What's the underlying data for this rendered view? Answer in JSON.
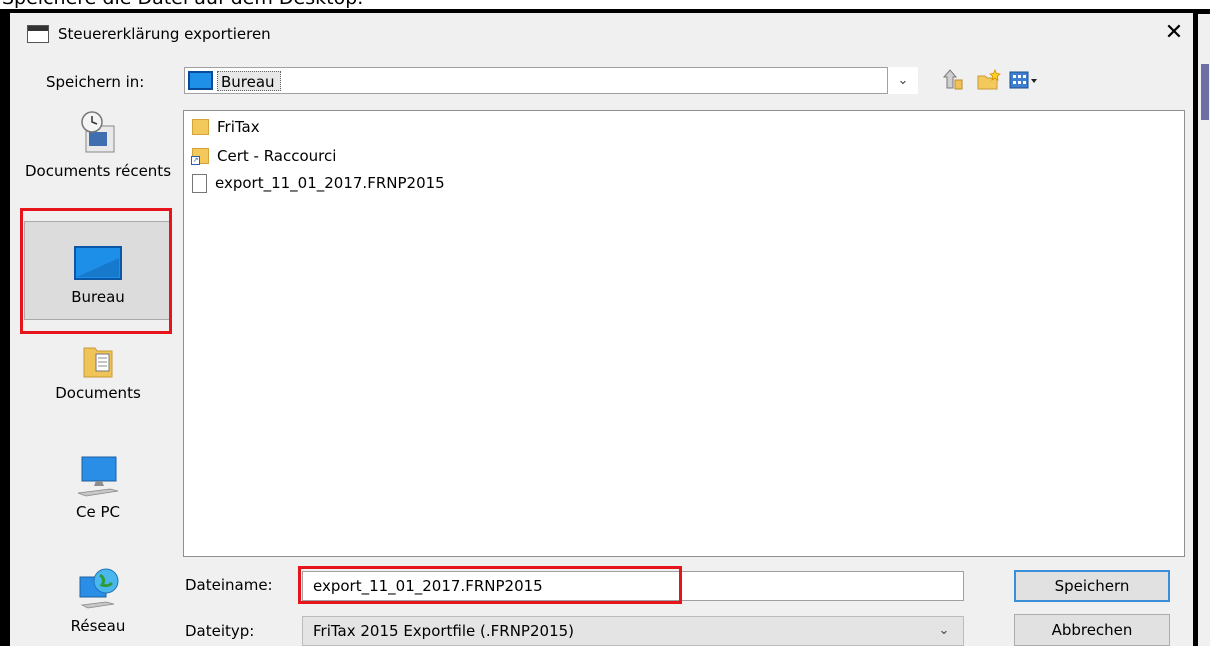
{
  "top_caption": "Speichere die Datei auf dem Desktop.",
  "window": {
    "title": "Steuererklärung exportieren",
    "close_glyph": "✕"
  },
  "save_in": {
    "label": "Speichern in:",
    "value": "Bureau",
    "icon": "desktop-icon"
  },
  "toolbar": {
    "icons": [
      "up-folder-icon",
      "new-folder-icon",
      "view-menu-icon"
    ]
  },
  "places": [
    {
      "label": "Documents récents",
      "icon": "recent-documents-icon"
    },
    {
      "label": "Bureau",
      "icon": "desktop-icon",
      "selected": true
    },
    {
      "label": "Documents",
      "icon": "documents-folder-icon"
    },
    {
      "label": "Ce PC",
      "icon": "computer-icon"
    },
    {
      "label": "Réseau",
      "icon": "network-globe-icon"
    }
  ],
  "files": [
    {
      "name": "FriTax",
      "type": "folder"
    },
    {
      "name": "Cert - Raccourci",
      "type": "folder-shortcut"
    },
    {
      "name": "export_11_01_2017.FRNP2015",
      "type": "file"
    }
  ],
  "file_name": {
    "label": "Dateiname:",
    "value": "export_11_01_2017.FRNP2015"
  },
  "file_type": {
    "label": "Dateityp:",
    "value": "FriTax 2015 Exportfile (.FRNP2015)"
  },
  "buttons": {
    "save": "Speichern",
    "cancel": "Abbrechen"
  },
  "colors": {
    "highlight": "#e8141b",
    "accent": "#3b8fd9",
    "dialog_bg": "#f0f0f0"
  }
}
